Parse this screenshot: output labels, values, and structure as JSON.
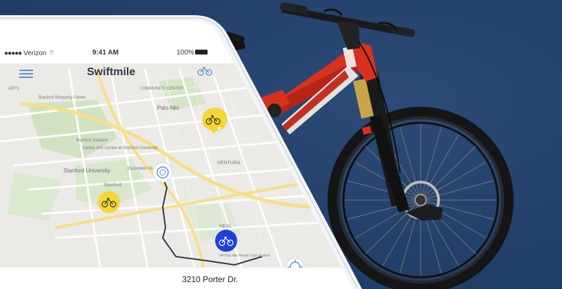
{
  "status_bar": {
    "carrier": "Verizon",
    "time": "9:41 AM",
    "battery": "100%"
  },
  "app": {
    "title": "Swiftmile"
  },
  "map": {
    "labels": {
      "community_center": "COMMUNITY CENTER",
      "palo_alto": "Palo Alto",
      "stanford_shopping": "Stanford Shopping Center",
      "stanford_stadium": "Stanford Stadium",
      "cantor_arts": "Cantor Arts Center at Stanford University",
      "stanford_university": "Stanford University",
      "stanford": "Stanford",
      "ventura": "VENTURA",
      "neal": "NEAL",
      "escondido": "Escondido Vil.",
      "arts": "ARTS",
      "va_health": "VA Palo Alto Health Care System"
    }
  },
  "destination": {
    "address": "3210 Porter Dr."
  },
  "colors": {
    "background": "#25426a",
    "bike_marker": "#f5d733",
    "selected_marker": "#1f3fd6",
    "route": "#2b3a4a",
    "frame_red": "#d8321f"
  },
  "icons": {
    "menu": "menu-icon",
    "bike": "bike-icon",
    "signal": "signal-icon",
    "wifi": "wifi-icon",
    "battery": "battery-icon",
    "location": "location-icon"
  }
}
